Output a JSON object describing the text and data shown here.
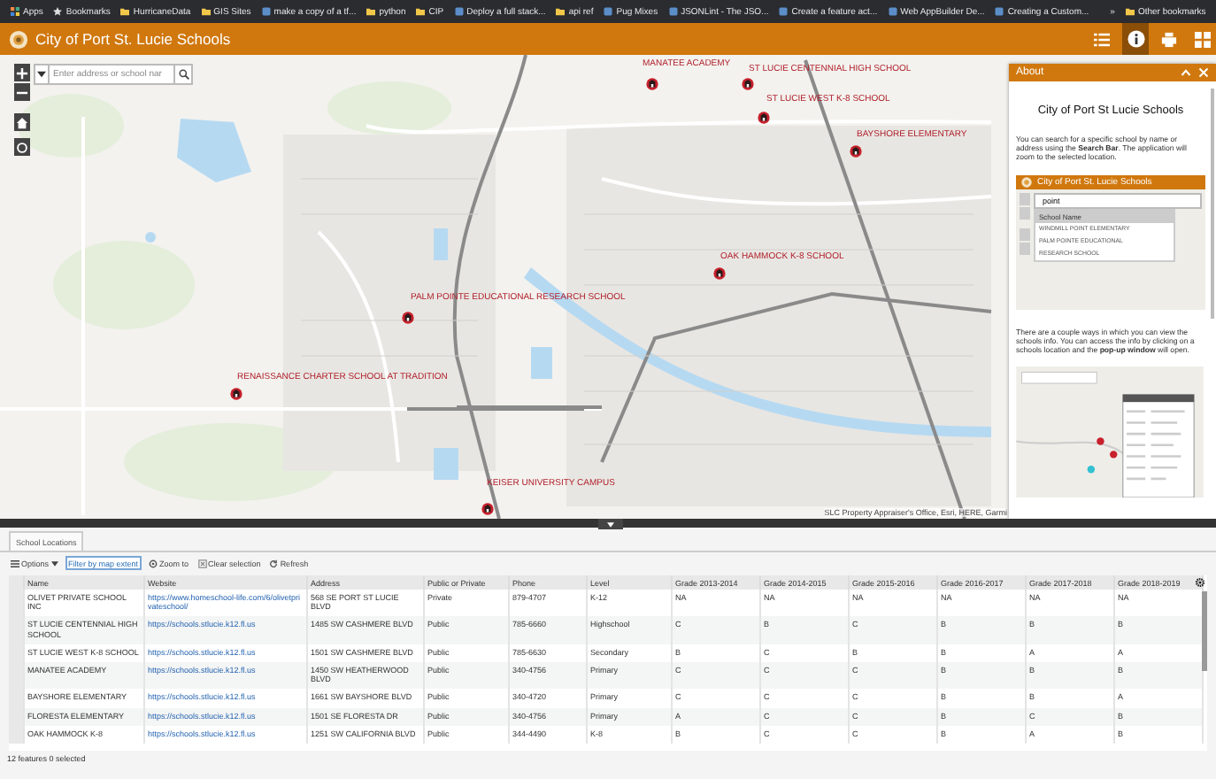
{
  "bookmarks_bar": {
    "items": [
      {
        "label": "Apps",
        "kind": "apps"
      },
      {
        "label": "Bookmarks",
        "kind": "star"
      },
      {
        "label": "HurricaneData",
        "kind": "folder"
      },
      {
        "label": "GIS Sites",
        "kind": "folder"
      },
      {
        "label": "make a copy of a tf...",
        "kind": "site"
      },
      {
        "label": "python",
        "kind": "folder"
      },
      {
        "label": "CIP",
        "kind": "folder"
      },
      {
        "label": "Deploy a full stack...",
        "kind": "site"
      },
      {
        "label": "api ref",
        "kind": "folder"
      },
      {
        "label": "Pug Mixes",
        "kind": "site"
      },
      {
        "label": "JSONLint - The JSO...",
        "kind": "site"
      },
      {
        "label": "Create a feature act...",
        "kind": "site"
      },
      {
        "label": "Web AppBuilder De...",
        "kind": "site"
      },
      {
        "label": "Creating a Custom...",
        "kind": "site"
      }
    ],
    "more": "»",
    "other": "Other bookmarks"
  },
  "app_header": {
    "title": "City of Port St. Lucie Schools",
    "tools": [
      {
        "kind": "list",
        "selected": false
      },
      {
        "kind": "info",
        "selected": true
      },
      {
        "kind": "print",
        "selected": false
      },
      {
        "kind": "grid",
        "selected": false
      }
    ]
  },
  "map": {
    "search": {
      "placeholder": "Enter address or school nar"
    },
    "school_labels": [
      {
        "name": "MANATEE ACADEMY"
      },
      {
        "name": "ST LUCIE CENTENNIAL HIGH SCHOOL"
      },
      {
        "name": "ST LUCIE WEST K-8 SCHOOL"
      },
      {
        "name": "BAYSHORE ELEMENTARY"
      },
      {
        "name": "OAK HAMMOCK K-8 SCHOOL"
      },
      {
        "name": "PALM POINTE EDUCATIONAL RESEARCH SCHOOL"
      },
      {
        "name": "RENAISSANCE CHARTER SCHOOL AT TRADITION"
      },
      {
        "name": "KEISER UNIVERSITY CAMPUS"
      }
    ],
    "attribution": "SLC Property Appraiser's Office, Esri, HERE, Garmi"
  },
  "about_panel": {
    "title": "About",
    "heading": "City of Port St Lucie Schools",
    "paragraphs": [
      "You can search for a specific school by name or address using the **Search Bar**. The application will zoom to the selected location.",
      "There are a couple ways in which you can view the schools info. You can access the info by clicking on a schools location and the **pop-up window** will open."
    ],
    "example": {
      "title": "City of Port St. Lucie Schools",
      "search_value": "point",
      "suggestion_header": "School Name",
      "suggestions": [
        "WINDMILL POINT ELEMENTARY",
        "PALM POINTE EDUCATIONAL",
        "RESEARCH SCHOOL"
      ]
    }
  },
  "table": {
    "tab": {
      "label": "School Locations",
      "selected": true
    },
    "toolbar": [
      {
        "label": "Options",
        "kind": "options"
      },
      {
        "label": "Filter by map extent",
        "kind": "filter"
      },
      {
        "label": "Zoom to",
        "kind": "zoom"
      },
      {
        "label": "Clear selection",
        "kind": "clear"
      },
      {
        "label": "Refresh",
        "kind": "refresh"
      }
    ],
    "columns": [
      {
        "label": "Name",
        "kind": "text"
      },
      {
        "label": "Website",
        "kind": "link"
      },
      {
        "label": "Address",
        "kind": "text"
      },
      {
        "label": "Public or Private",
        "kind": "text"
      },
      {
        "label": "Phone",
        "kind": "text"
      },
      {
        "label": "Level",
        "kind": "text"
      },
      {
        "label": "Grade 2013-2014",
        "kind": "text"
      },
      {
        "label": "Grade 2014-2015",
        "kind": "text"
      },
      {
        "label": "Grade 2015-2016",
        "kind": "text"
      },
      {
        "label": "Grade 2016-2017",
        "kind": "text"
      },
      {
        "label": "Grade 2017-2018",
        "kind": "text"
      },
      {
        "label": "Grade 2018-2019",
        "kind": "text"
      }
    ],
    "rows": [
      {
        "cells": [
          "OLIVET PRIVATE SCHOOL INC",
          "https://www.homeschool-life.com/6/olivetprivateschool/",
          "568 SE PORT ST LUCIE BLVD",
          "Private",
          "879-4707",
          "K-12",
          "NA",
          "NA",
          "NA",
          "NA",
          "NA",
          "NA"
        ]
      },
      {
        "cells": [
          "ST LUCIE CENTENNIAL HIGH SCHOOL",
          "https://schools.stlucie.k12.fl.us",
          "1485 SW CASHMERE BLVD",
          "Public",
          "785-6660",
          "Highschool",
          "C",
          "B",
          "C",
          "B",
          "B",
          "B"
        ]
      },
      {
        "cells": [
          "ST LUCIE WEST K-8 SCHOOL",
          "https://schools.stlucie.k12.fl.us",
          "1501 SW CASHMERE BLVD",
          "Public",
          "785-6630",
          "Secondary",
          "B",
          "C",
          "B",
          "B",
          "A",
          "A"
        ]
      },
      {
        "cells": [
          "MANATEE ACADEMY",
          "https://schools.stlucie.k12.fl.us",
          "1450 SW HEATHERWOOD BLVD",
          "Public",
          "340-4756",
          "Primary",
          "C",
          "C",
          "C",
          "B",
          "B",
          "B"
        ]
      },
      {
        "cells": [
          "BAYSHORE ELEMENTARY",
          "https://schools.stlucie.k12.fl.us",
          "1661 SW BAYSHORE BLVD",
          "Public",
          "340-4720",
          "Primary",
          "C",
          "C",
          "C",
          "B",
          "B",
          "A"
        ]
      },
      {
        "cells": [
          "FLORESTA ELEMENTARY",
          "https://schools.stlucie.k12.fl.us",
          "1501 SE FLORESTA DR",
          "Public",
          "340-4756",
          "Primary",
          "A",
          "C",
          "C",
          "B",
          "C",
          "B"
        ]
      },
      {
        "cells": [
          "OAK HAMMOCK K-8",
          "https://schools.stlucie.k12.fl.us",
          "1251 SW CALIFORNIA BLVD",
          "Public",
          "344-4490",
          "K-8",
          "B",
          "C",
          "C",
          "B",
          "A",
          "B"
        ]
      }
    ],
    "footer": "12 features 0 selected"
  }
}
